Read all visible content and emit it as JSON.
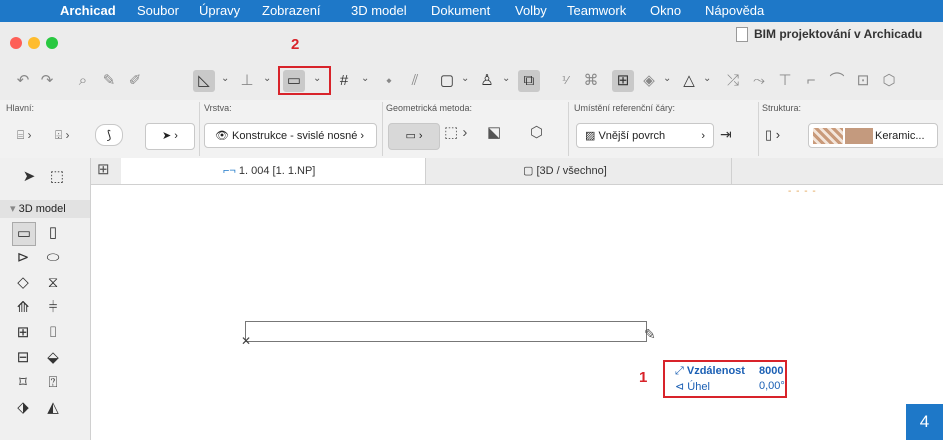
{
  "menubar": {
    "app_name": "Archicad",
    "items": [
      "Soubor",
      "Úpravy",
      "Zobrazení",
      "3D model",
      "Dokument",
      "Volby",
      "Teamwork",
      "Okno",
      "Nápověda"
    ]
  },
  "window": {
    "title": "BIM projektování v Archicadu",
    "callout_2": "2"
  },
  "infobox": {
    "hlavni_label": "Hlavní:",
    "vrstva_label": "Vrstva:",
    "vrstva_value": "Konstrukce - svislé nosné",
    "geom_label": "Geometrická metoda:",
    "ref_label": "Umístění referenční čáry:",
    "ref_value": "Vnější povrch",
    "struct_label": "Struktura:",
    "struct_value": "Keramic..."
  },
  "toolbox": {
    "section": "3D model"
  },
  "tabs": [
    {
      "label": "1. 004 [1. 1.NP]"
    },
    {
      "label": "[3D / všechno]"
    }
  ],
  "canvas": {
    "dashes": "- - - -",
    "tracker": {
      "distance_label": "Vzdálenost",
      "distance_value": "8000",
      "angle_label": "Úhel",
      "angle_value": "0,00°"
    },
    "callout_1": "1"
  },
  "page_number": "4",
  "colors": {
    "menubar": "#1e78c8",
    "callout": "#d8232a",
    "tracker_text": "#1a5fb4"
  }
}
